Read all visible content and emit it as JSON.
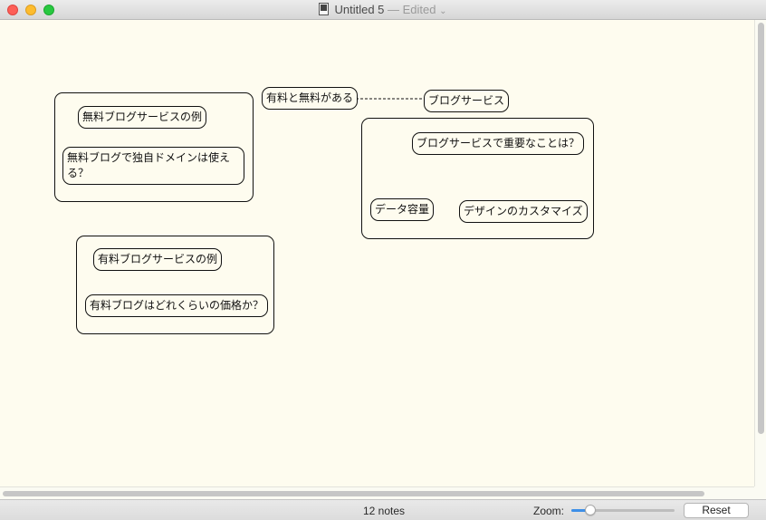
{
  "window": {
    "title": "Untitled 5",
    "separator": " — ",
    "status": "Edited",
    "dropdown_glyph": "⌄"
  },
  "groups": [
    {
      "name": "free-blog-group"
    },
    {
      "name": "blog-service-group"
    },
    {
      "name": "paid-blog-group"
    }
  ],
  "notes": {
    "free_blog_examples": "無料ブログサービスの例",
    "free_blog_domain": "無料ブログで独自ドメインは使える？",
    "paid_and_free": "有料と無料がある",
    "blog_service": "ブログサービス",
    "important_points": "ブログサービスで重要なことは？",
    "data_capacity": "データ容量",
    "design_customize": "デザインのカスタマイズ",
    "paid_blog_examples": "有料ブログサービスの例",
    "paid_blog_price": "有料ブログはどれくらいの価格か？"
  },
  "status_bar": {
    "notes_count": "12 notes",
    "zoom_label": "Zoom:",
    "zoom_level": 0.15,
    "reset_label": "Reset"
  },
  "colors": {
    "canvas_bg": "#fefcef",
    "accent": "#3d8fe8",
    "close": "#fd5f57",
    "minimize": "#fdbc2e",
    "zoom": "#28c840"
  },
  "icons": [
    "close-window-icon",
    "minimize-window-icon",
    "zoom-window-icon",
    "document-icon",
    "chevron-down-icon"
  ]
}
